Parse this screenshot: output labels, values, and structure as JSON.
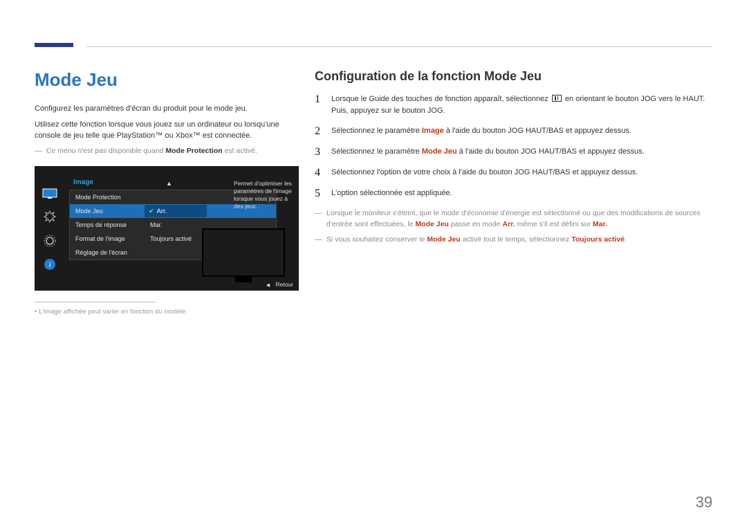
{
  "left": {
    "title": "Mode Jeu",
    "p1": "Configurez les paramètres d'écran du produit pour le mode jeu.",
    "p2": "Utilisez cette fonction lorsque vous jouez sur un ordinateur ou lorsqu'une console de jeu telle que PlayStation™ ou Xbox™ est connectée.",
    "note_prefix": "Ce menu n'est pas disponible quand ",
    "note_bold": "Mode Protection",
    "note_suffix": " est activé.",
    "caption": "L'image affichée peut varier en fonction du modèle."
  },
  "osd": {
    "title": "Image",
    "rows": [
      {
        "label": "Mode Protection",
        "value": ""
      },
      {
        "label": "Mode Jeu",
        "value": "Arr."
      },
      {
        "label": "Temps de réponse",
        "value": "Mar."
      },
      {
        "label": "Format de l'image",
        "value": "Toujours activé"
      },
      {
        "label": "Réglage de l'écran",
        "value": ""
      }
    ],
    "desc": "Permet d'optimiser les paramètres de l'image lorsque vous jouez à des jeux.",
    "back": "Retour"
  },
  "right": {
    "heading": "Configuration de la fonction Mode Jeu",
    "steps": {
      "s1a": "Lorsque le Guide des touches de fonction apparaît, sélectionnez ",
      "s1b": " en orientant le bouton JOG vers le HAUT. Puis, appuyez sur le bouton JOG.",
      "s2a": "Sélectionnez le paramètre ",
      "s2b": "Image",
      "s2c": " à l'aide du bouton JOG HAUT/BAS et appuyez dessus.",
      "s3a": "Sélectionnez le paramètre ",
      "s3b": "Mode Jeu",
      "s3c": " à l'aide du bouton JOG HAUT/BAS et appuyez dessus.",
      "s4": "Sélectionnez l'option de votre choix à l'aide du bouton JOG HAUT/BAS et appuyez dessus.",
      "s5": "L'option sélectionnée est appliquée."
    },
    "notes": {
      "n1a": "Lorsque le moniteur s'éteint, que le mode d'économie d'énergie est sélectionné ou que des modifications de sources d'entrée sont effectuées, le ",
      "n1b": "Mode Jeu",
      "n1c": " passe en mode ",
      "n1d": "Arr.",
      "n1e": " même s'il est défini sur ",
      "n1f": "Mar.",
      "n2a": "Si vous souhaitez conserver le ",
      "n2b": "Mode Jeu",
      "n2c": " activé tout le temps, sélectionnez ",
      "n2d": "Toujours activé",
      "n2e": "."
    }
  },
  "page_number": "39"
}
